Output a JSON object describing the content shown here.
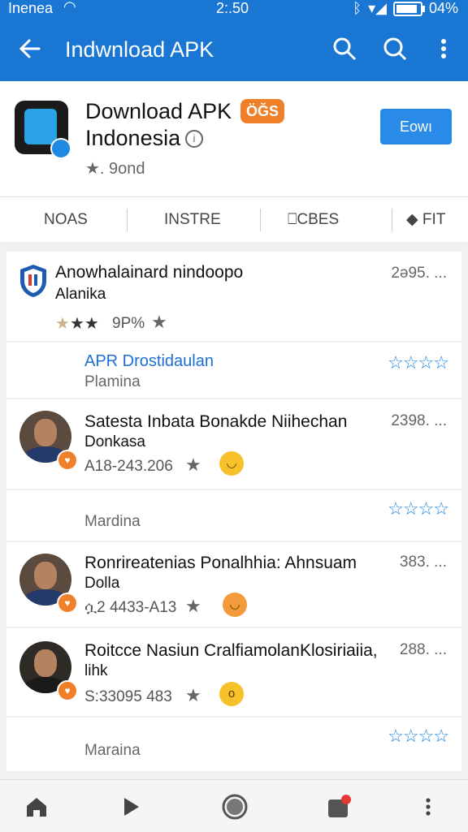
{
  "status_bar": {
    "carrier": "Inenea",
    "time": "2:.50",
    "battery": "04%",
    "battery_level": 0.9
  },
  "app_bar": {
    "title": "Indwnload APK",
    "back_icon": "arrow-left-icon",
    "search_icon": "search-icon",
    "search2_icon": "search-icon",
    "more_icon": "more-vert-icon"
  },
  "app": {
    "title_line1": "Download APK",
    "tag": "ÖĞS",
    "title_line2": "Indonesia",
    "rating": "★. 9ond",
    "install_label": "Eowı",
    "accent": "#1976d2"
  },
  "tabs": [
    {
      "label": "NOAS"
    },
    {
      "label": "INSTRE"
    },
    {
      "label": "⎕CBES"
    },
    {
      "label": "FIT"
    }
  ],
  "reviews": [
    {
      "title": "Anowhalainard nindoopo",
      "sub": "Alanika",
      "meta": "9P%",
      "right": "2ə95. ...",
      "icon": "shield-icon"
    },
    {
      "link": "APR Drostidaulan",
      "sub": "Plamina"
    },
    {
      "title": "Satesta Inbata Bonakde Niihechan",
      "sub": "Donkasa",
      "meta": "A18-243.206",
      "right": "2398. ..."
    },
    {
      "grey": "Mardina"
    },
    {
      "title": "Ronrireatenias Ponalhhia: Ahnsuam",
      "sub": "Dolla",
      "meta": "ሷ2 4433-A13",
      "right": "383. ..."
    },
    {
      "title": "Roitcce Nasiun CralfiamolanKlosiriaiia,",
      "sub": "lihk",
      "meta": "S:33095 483",
      "right": "288. ..."
    },
    {
      "grey": "Maraina"
    }
  ],
  "bottom_nav": {
    "home_icon": "home-icon",
    "play_icon": "play-icon",
    "record_icon": "circle-icon",
    "notif_icon": "notification-icon",
    "more_icon": "more-vert-icon"
  }
}
